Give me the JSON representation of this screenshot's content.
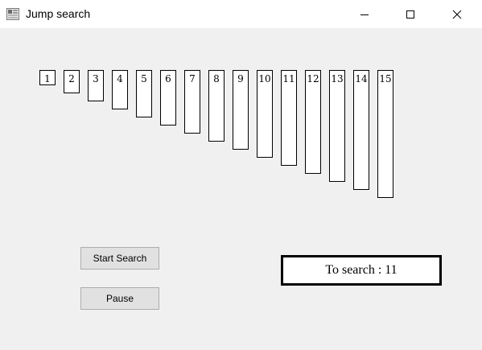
{
  "window": {
    "title": "Jump search",
    "app_icon": "application-icon",
    "controls": [
      "minimize-icon",
      "maximize-icon",
      "close-icon"
    ]
  },
  "array": {
    "values": [
      1,
      2,
      3,
      4,
      5,
      6,
      7,
      8,
      9,
      10,
      11,
      12,
      13,
      14,
      15
    ],
    "labels": [
      "1",
      "2",
      "3",
      "4",
      "5",
      "6",
      "7",
      "8",
      "9",
      "10",
      "11",
      "12",
      "13",
      "14",
      "15"
    ]
  },
  "buttons": {
    "start": "Start Search",
    "pause": "Pause"
  },
  "search": {
    "text": "To search : 11"
  },
  "colors": {
    "background": "#f0f0f0",
    "bar_fill": "#ffffff",
    "bar_border": "#000000",
    "button_fill": "#e1e1e1"
  }
}
